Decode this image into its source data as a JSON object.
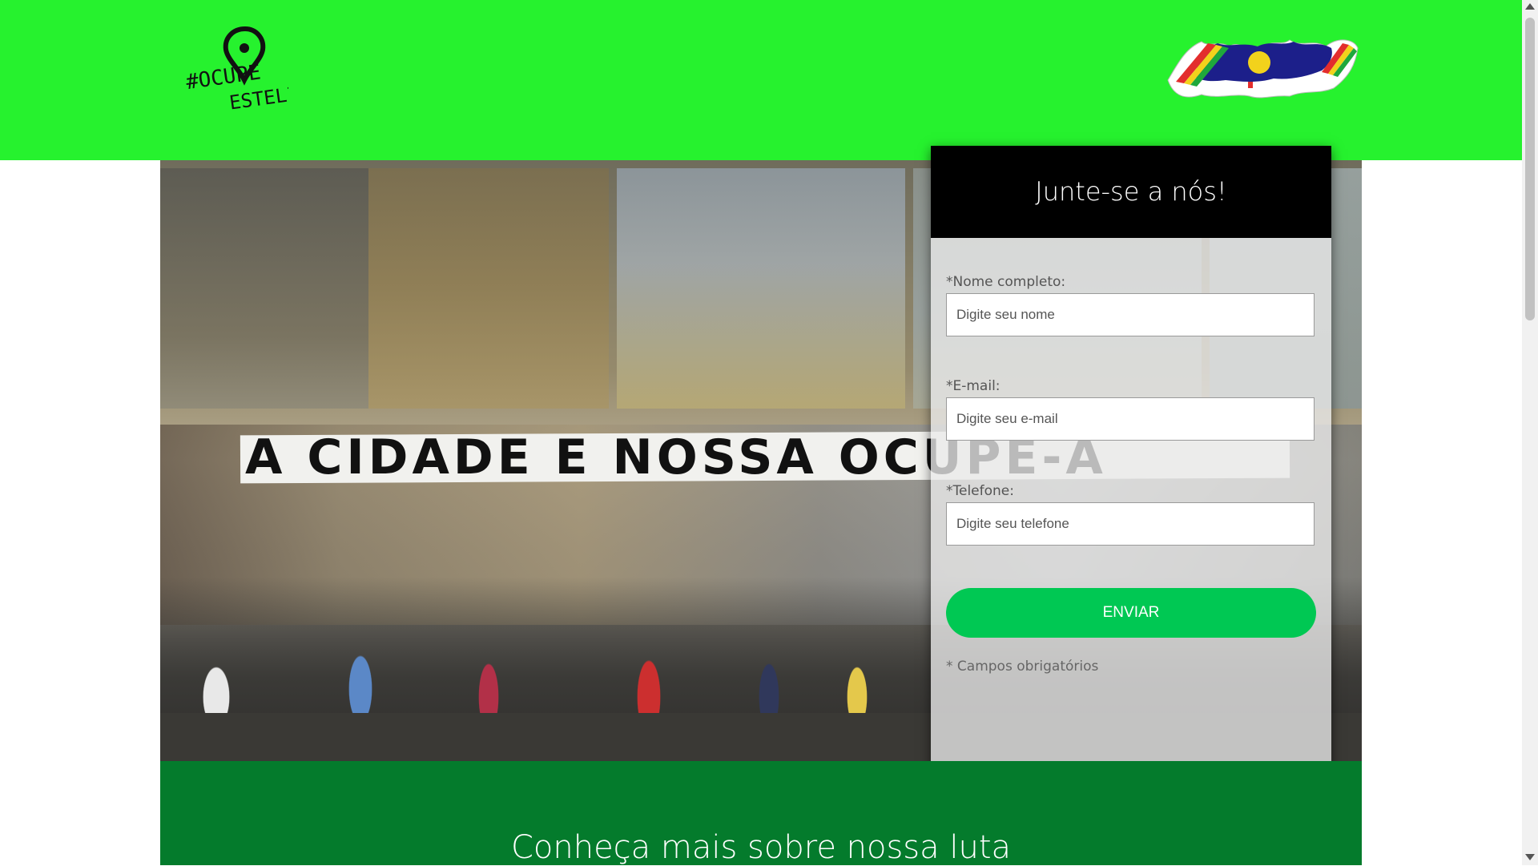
{
  "header": {
    "logo_text": "#OCUPE ESTELITA",
    "logo_icon": "map-pin-icon",
    "flag_icon": "pernambuco-map-flag-icon",
    "background_color": "#26f22e"
  },
  "hero": {
    "banner_text": "A CIDADE E NOSSA OCUPE-A"
  },
  "signup": {
    "title": "Junte-se a nós!",
    "fields": [
      {
        "label": "*Nome completo:",
        "placeholder": "Digite seu nome"
      },
      {
        "label": "*E-mail:",
        "placeholder": "Digite seu e-mail"
      },
      {
        "label": "*Telefone:",
        "placeholder": "Digite seu telefone"
      }
    ],
    "submit_label": "ENVIAR",
    "required_note": "* Campos obrigatórios",
    "button_color": "#00c853"
  },
  "section": {
    "title": "Conheça mais sobre nossa luta",
    "background_color": "#047b2c"
  }
}
